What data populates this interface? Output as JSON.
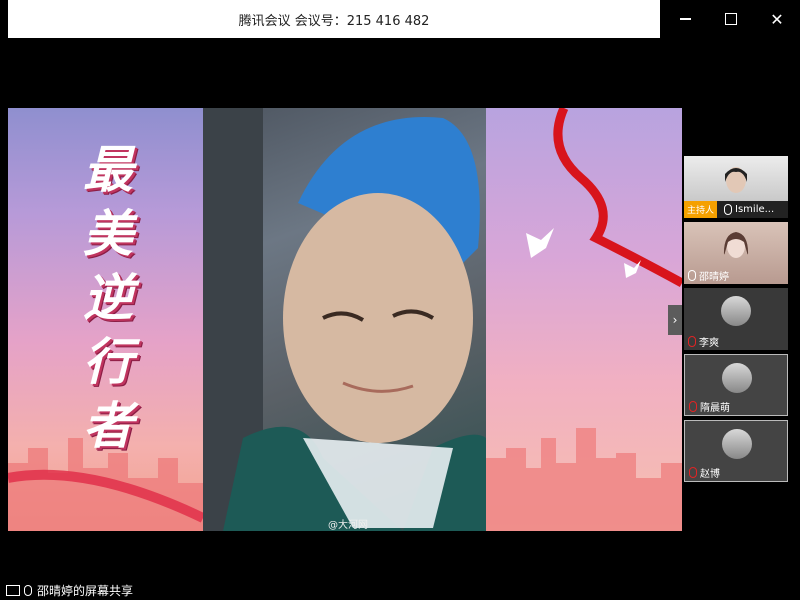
{
  "window": {
    "title": "腾讯会议 会议号：215 416 482",
    "controls": {
      "minimize": "minimize-icon",
      "maximize": "maximize-icon",
      "close": "close-icon"
    }
  },
  "share": {
    "title_chars": [
      "最",
      "美",
      "逆",
      "行",
      "者"
    ],
    "watermark": "@大河网"
  },
  "participants": {
    "host_badge": "主持人",
    "list": [
      {
        "name": "Ismile...",
        "muted": false,
        "host": true
      },
      {
        "name": "邵晴婷",
        "muted": false,
        "host": false
      },
      {
        "name": "李爽",
        "muted": true,
        "host": false
      },
      {
        "name": "隋晨萌",
        "muted": true,
        "host": false
      },
      {
        "name": "赵博",
        "muted": true,
        "host": false
      }
    ],
    "expand_icon": "chevron-right-icon"
  },
  "status": {
    "text": "邵晴婷的屏幕共享"
  },
  "colors": {
    "host_badge": "#f5a000",
    "mute": "#e02424"
  }
}
